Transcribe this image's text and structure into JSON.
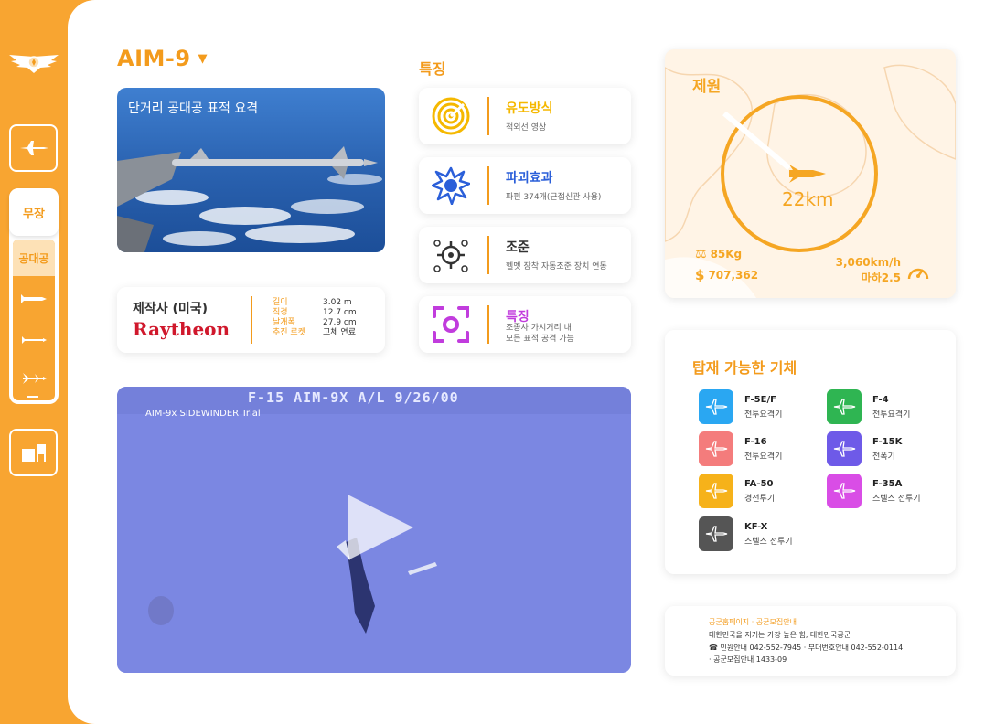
{
  "sidebar": {
    "active_label": "무장",
    "sub_label": "공대공",
    "colors": {
      "accent": "#f8a531",
      "sub_bg": "#fde1b6"
    }
  },
  "header": {
    "title": "AIM-9"
  },
  "image_card": {
    "caption": "단거리 공대공 표적 요격"
  },
  "maker": {
    "label": "제작사 (미국)",
    "brand": "Raytheon",
    "specs": [
      {
        "key": "길이",
        "value": "3.02 m"
      },
      {
        "key": "직경",
        "value": "12.7 cm"
      },
      {
        "key": "날개폭",
        "value": "27.9 cm"
      },
      {
        "key": "추진 로켓",
        "value": "고체 연료"
      }
    ]
  },
  "features": {
    "title": "특징",
    "items": [
      {
        "title": "유도방식",
        "desc": "적외선 영상",
        "color": "#f5b800",
        "icon": "radar-icon"
      },
      {
        "title": "파괴효과",
        "desc": "파편 374개(근접신관 사용)",
        "color": "#2b5fd9",
        "icon": "explosion-icon"
      },
      {
        "title": "조준",
        "desc": "헬멧 장착 자동조준 장치 연동",
        "color": "#333333",
        "icon": "crosshair-icon"
      },
      {
        "title": "특징",
        "desc1": "조종사 가시거리 내",
        "desc2": "모든 표적 공격 가능",
        "color": "#c13cdd",
        "icon": "target-frame-icon"
      }
    ]
  },
  "video": {
    "overlay_text": "F-15 AIM-9X A/L 9/26/00",
    "caption": "AIM-9x SIDEWINDER Trial"
  },
  "spec": {
    "title": "제원",
    "range": "22km",
    "weight": "85Kg",
    "price": "707,362",
    "speed": "3,060km/h",
    "mach": "마하2.5"
  },
  "planes": {
    "title": "탑재 가능한 기체",
    "items": [
      {
        "name": "F-5E/F",
        "type": "전투요격기",
        "color": "#2aa7f2"
      },
      {
        "name": "F-4",
        "type": "전투요격기",
        "color": "#2fb552"
      },
      {
        "name": "F-16",
        "type": "전투요격기",
        "color": "#f47c7c"
      },
      {
        "name": "F-15K",
        "type": "전폭기",
        "color": "#6e5ae8"
      },
      {
        "name": "FA-50",
        "type": "경전투기",
        "color": "#f6b21a"
      },
      {
        "name": "F-35A",
        "type": "스텔스 전투기",
        "color": "#d94de6"
      },
      {
        "name": "KF-X",
        "type": "스텔스 전투기",
        "color": "#555555"
      }
    ]
  },
  "footer": {
    "links": "공군홈페이지 · 공군모집안내",
    "line1": "대한민국을 지키는 가장 높은 힘, 대한민국공군",
    "line2": "☎ 민원안내  042-552-7945  · 부대번호안내  042-552-0114",
    "line3": "· 공군모집안내  1433-09"
  }
}
